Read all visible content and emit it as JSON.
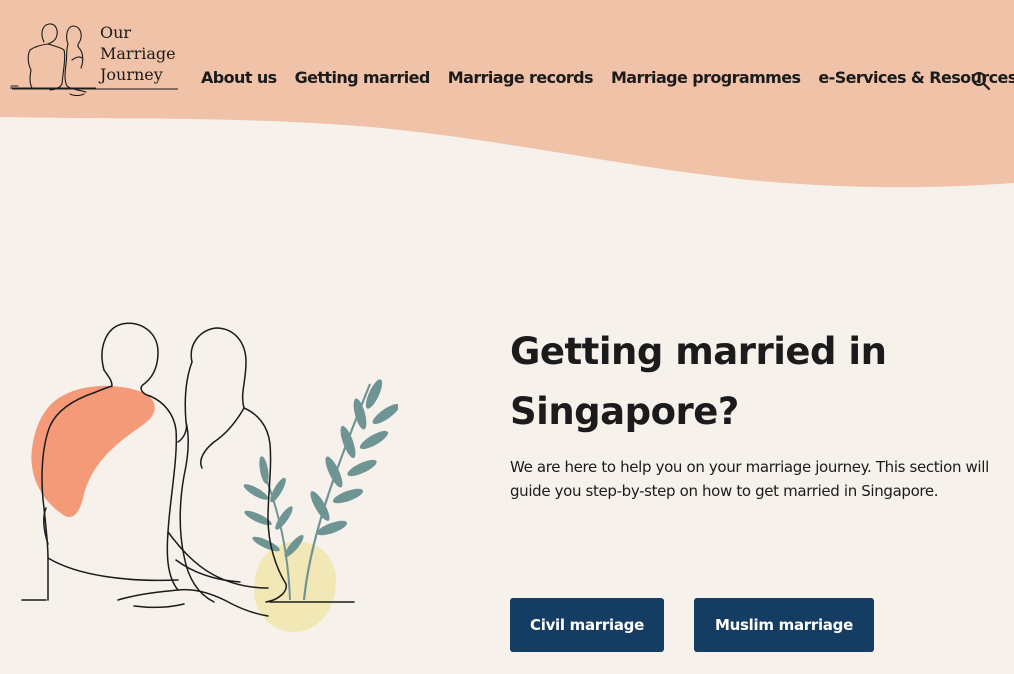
{
  "colors": {
    "header_bg": "#f0c2a7",
    "page_bg": "#f7f1ec",
    "button_bg": "#153c63",
    "button_text": "#ffffff",
    "accent_orange": "#f59a78",
    "accent_yellow": "#f2e8b6",
    "leaf_green": "#6f9494"
  },
  "logo": {
    "line1": "Our",
    "line2": "Marriage",
    "line3": "Journey",
    "icon": "couple-line-art-icon"
  },
  "nav": {
    "items": [
      {
        "label": "About us"
      },
      {
        "label": "Getting married"
      },
      {
        "label": "Marriage records"
      },
      {
        "label": "Marriage programmes"
      },
      {
        "label": "e-Services & Resources"
      }
    ],
    "search_icon": "search-icon"
  },
  "hero": {
    "title_line1": "Getting married in",
    "title_line2": "Singapore?",
    "description": "We are here to help you on your marriage journey. This section will guide you step-by-step on how to get married in Singapore.",
    "illustration": "couple-sitting-illustration",
    "buttons": {
      "civil": "Civil marriage",
      "muslim": "Muslim marriage"
    }
  }
}
